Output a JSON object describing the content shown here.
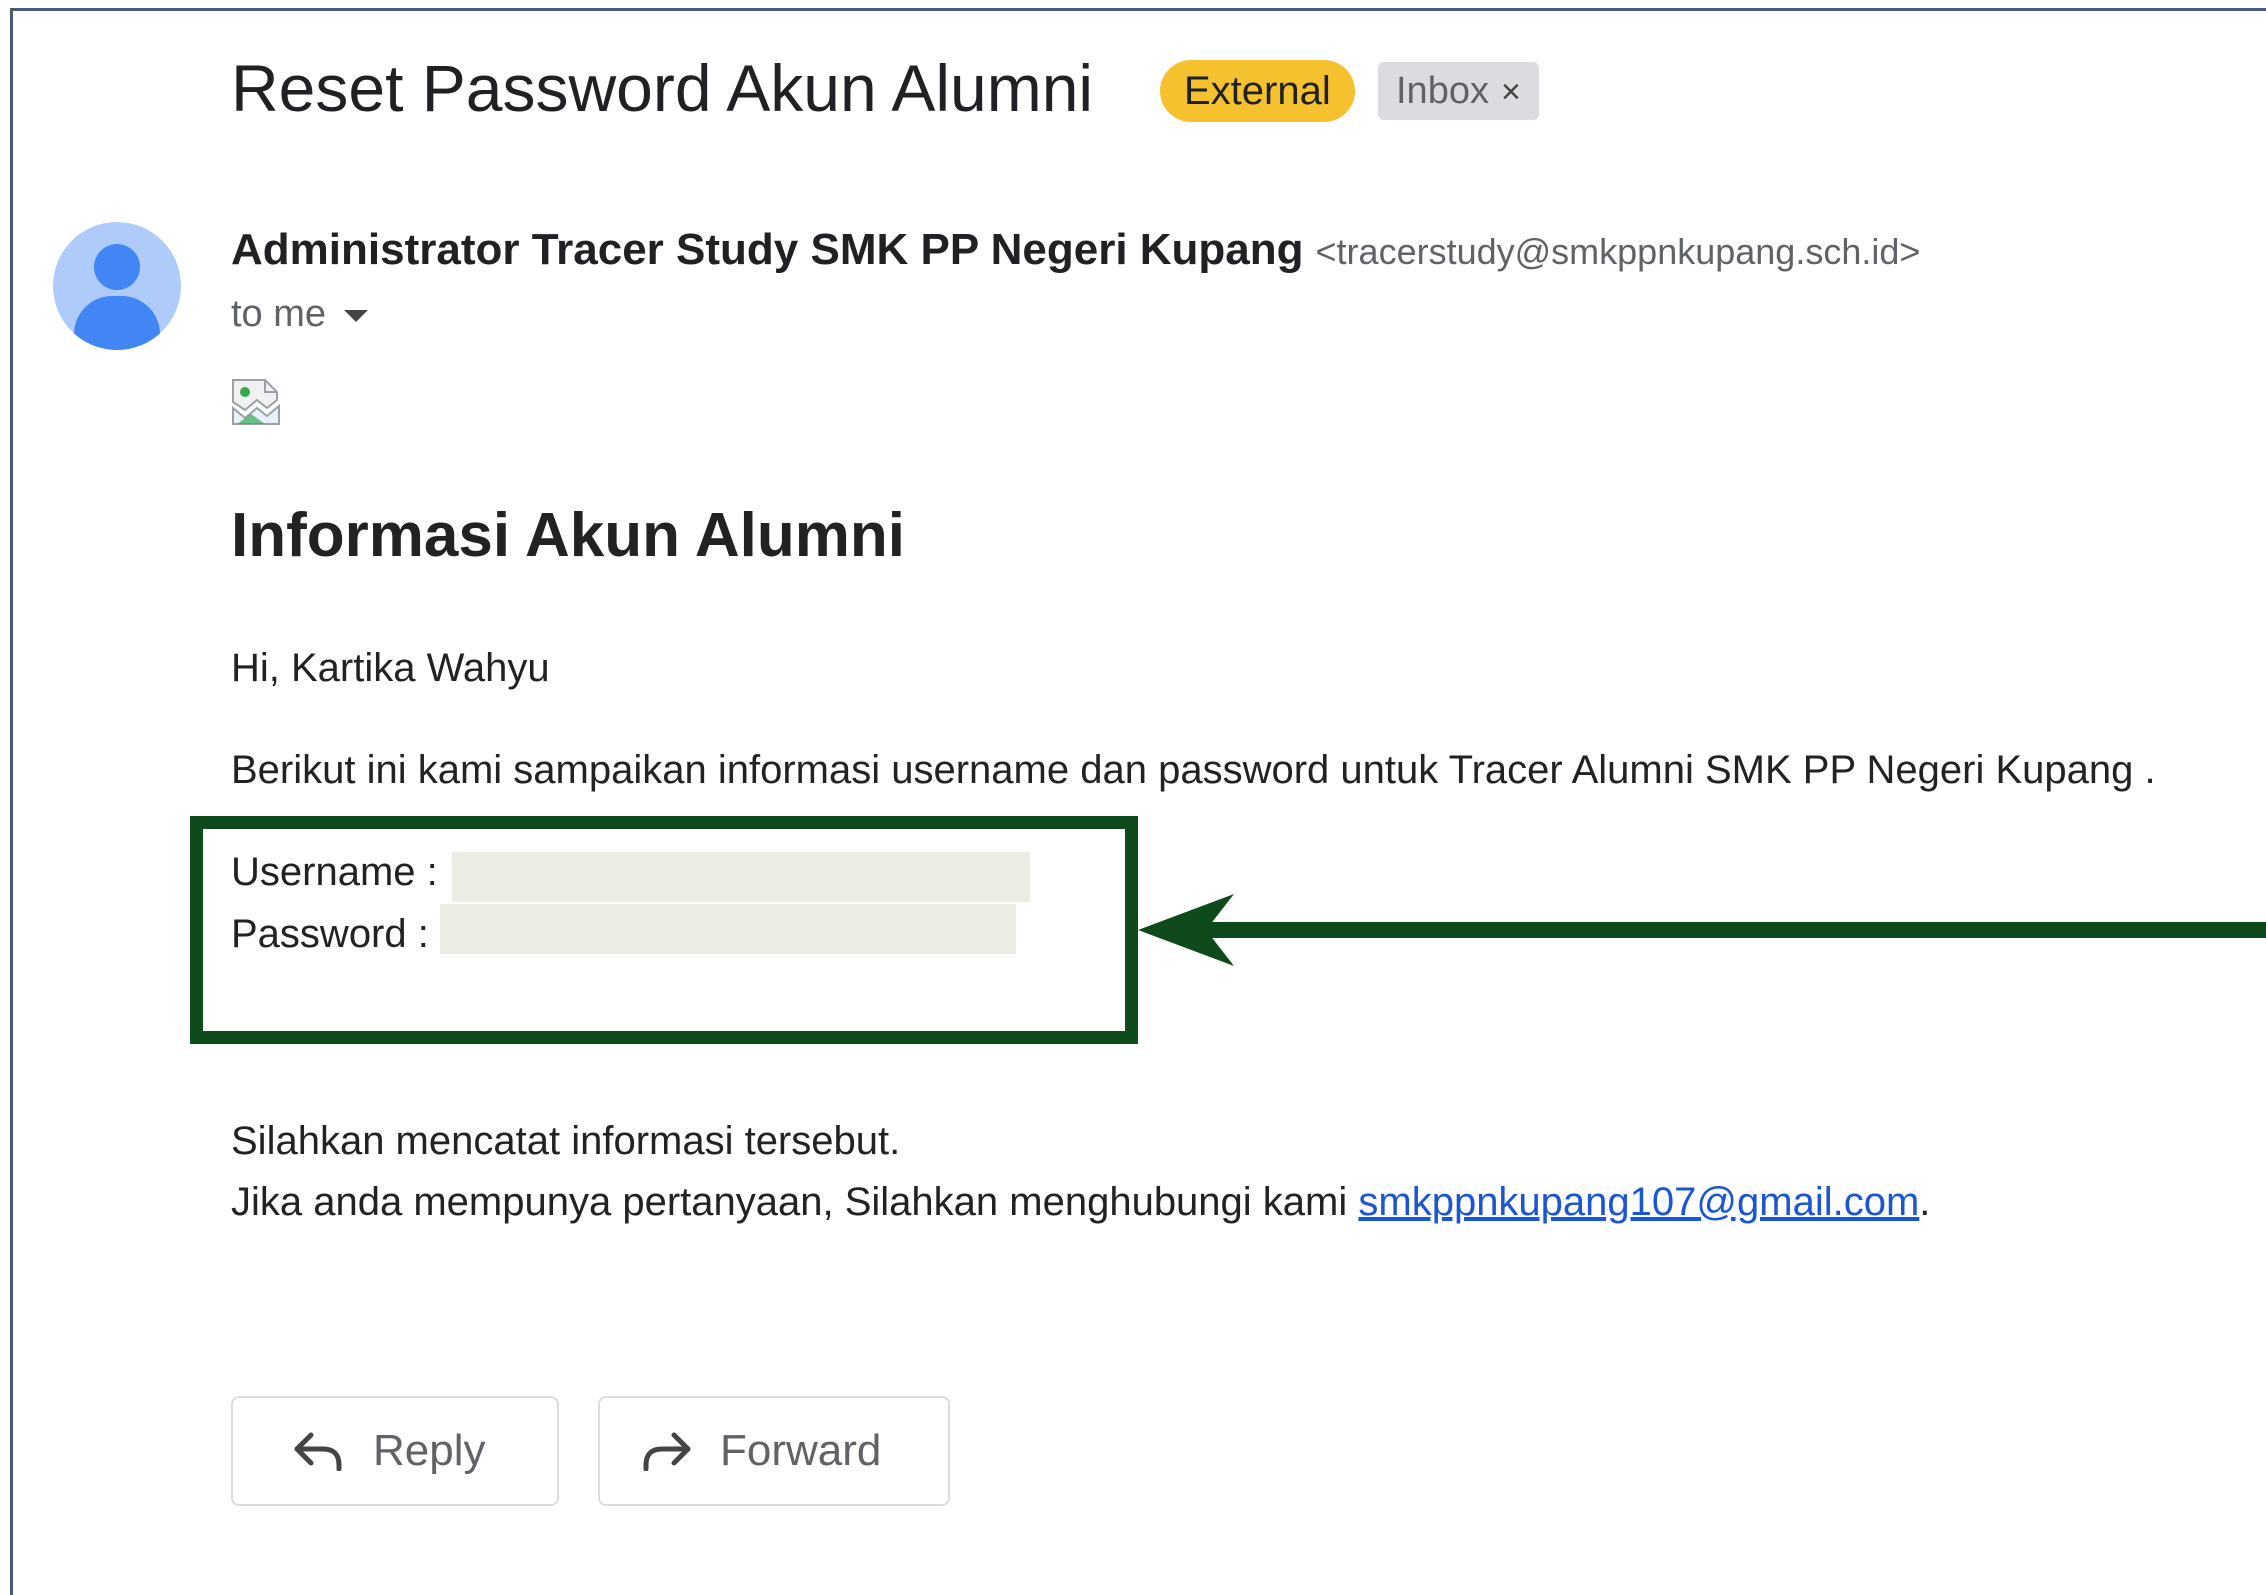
{
  "email": {
    "subject": "Reset Password Akun Alumni",
    "labels": {
      "external": "External",
      "inbox": "Inbox",
      "inbox_remove": "×"
    },
    "sender": {
      "name": "Administrator Tracer Study SMK PP Negeri Kupang",
      "email": "<tracerstudy@smkppnkupang.sch.id>"
    },
    "recipient": "to me",
    "heading": "Informasi Akun Alumni",
    "greeting": "Hi, Kartika Wahyu",
    "intro": "Berikut ini kami sampaikan informasi username dan password untuk Tracer Alumni SMK PP Negeri Kupang .",
    "username_label": "Username :",
    "password_label": "Password :",
    "note": "Silahkan mencatat informasi tersebut.",
    "contact_prefix": "Jika anda mempunya pertanyaan, Silahkan menghubungi kami ",
    "contact_email": "smkppnkupang107@gmail.com",
    "contact_suffix": "."
  },
  "actions": {
    "reply_label": "Reply",
    "forward_label": "Forward"
  },
  "colors": {
    "external_label": "#f5c12e",
    "inbox_label": "#dadce0",
    "avatar_bg": "#aecbfa",
    "avatar_fg": "#4285f4",
    "annotation": "#0f4a1c",
    "link": "#1a55d6"
  },
  "icons": {
    "reply": "reply-arrow-icon",
    "forward": "forward-arrow-icon",
    "avatar": "person-icon",
    "expand": "caret-down-icon",
    "image": "broken-image-icon"
  }
}
